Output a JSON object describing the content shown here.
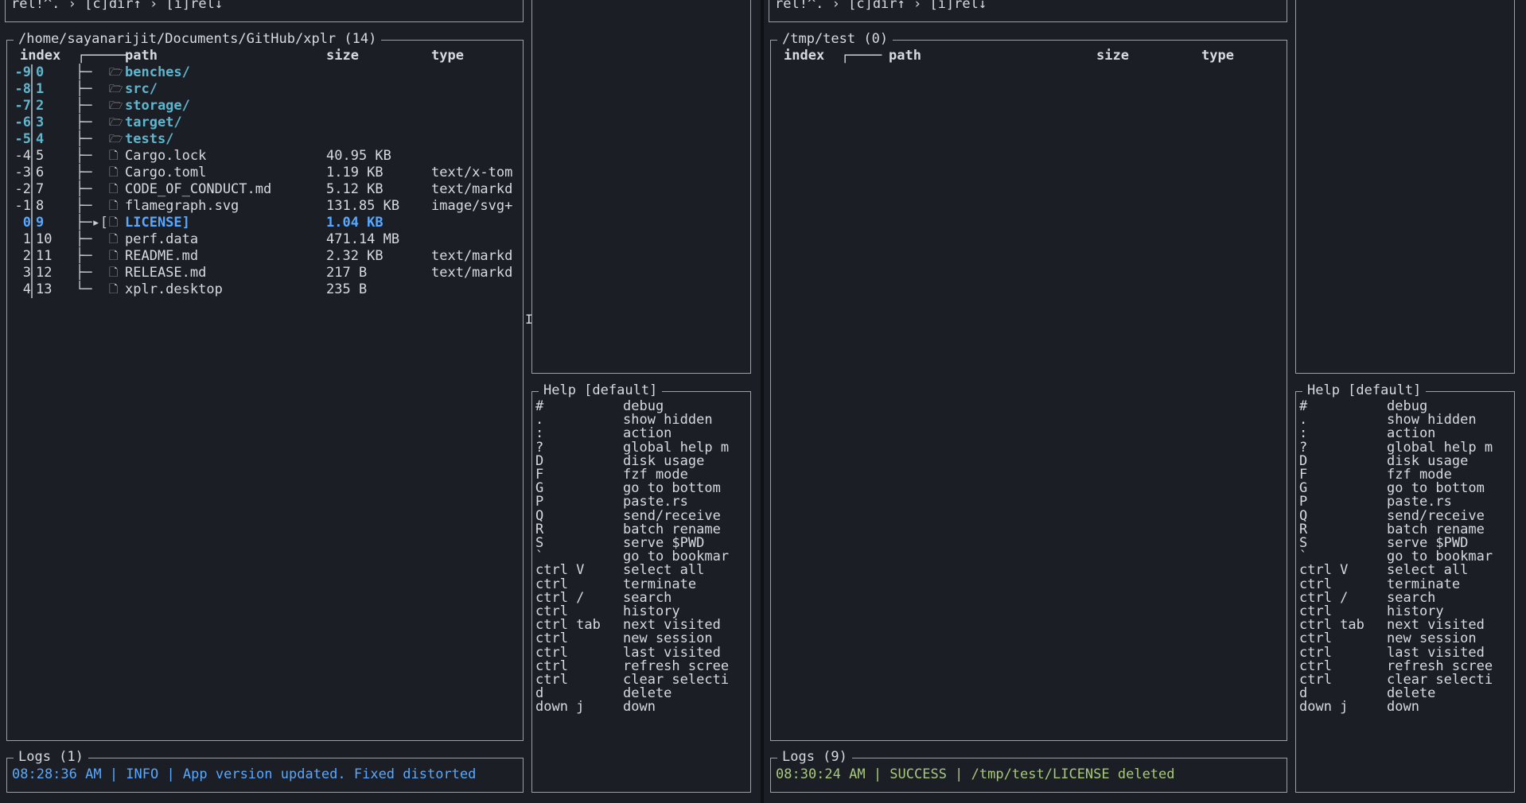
{
  "left": {
    "breadcrumb": "rel!^. › [c]dir↑ › [i]rel↓",
    "table_title": "/home/sayanarijit/Documents/GitHub/xplr (14)",
    "columns": {
      "index": "index",
      "tree": "┌─────",
      "path": "path",
      "size": "size",
      "type": "type"
    },
    "rows": [
      {
        "rel": "-9",
        "idx": "0",
        "tree": "├─",
        "icon": "🗁",
        "path": "benches/",
        "size": "",
        "type": "",
        "kind": "dir"
      },
      {
        "rel": "-8",
        "idx": "1",
        "tree": "├─",
        "icon": "🗁",
        "path": "src/",
        "size": "",
        "type": "",
        "kind": "dir"
      },
      {
        "rel": "-7",
        "idx": "2",
        "tree": "├─",
        "icon": "🗁",
        "path": "storage/",
        "size": "",
        "type": "",
        "kind": "dir"
      },
      {
        "rel": "-6",
        "idx": "3",
        "tree": "├─",
        "icon": "🗁",
        "path": "target/",
        "size": "",
        "type": "",
        "kind": "dir"
      },
      {
        "rel": "-5",
        "idx": "4",
        "tree": "├─",
        "icon": "🗁",
        "path": "tests/",
        "size": "",
        "type": "",
        "kind": "dir"
      },
      {
        "rel": "-4",
        "idx": "5",
        "tree": "├─",
        "icon": "🗋",
        "path": "Cargo.lock",
        "size": "40.95 KB",
        "type": "",
        "kind": "file"
      },
      {
        "rel": "-3",
        "idx": "6",
        "tree": "├─",
        "icon": "🗋",
        "path": "Cargo.toml",
        "size": "1.19 KB",
        "type": "text/x-tom",
        "kind": "file"
      },
      {
        "rel": "-2",
        "idx": "7",
        "tree": "├─",
        "icon": "🗋",
        "path": "CODE_OF_CONDUCT.md",
        "size": "5.12 KB",
        "type": "text/markd",
        "kind": "file"
      },
      {
        "rel": "-1",
        "idx": "8",
        "tree": "├─",
        "icon": "🗋",
        "path": "flamegraph.svg",
        "size": "131.85 KB",
        "type": "image/svg+",
        "kind": "file"
      },
      {
        "rel": "0",
        "idx": "9",
        "tree": "├─▸[",
        "icon": "🗋",
        "path": "LICENSE]",
        "size": "1.04 KB",
        "type": "",
        "kind": "selected"
      },
      {
        "rel": "1",
        "idx": "10",
        "tree": "├─",
        "icon": "🗋",
        "path": "perf.data",
        "size": "471.14 MB",
        "type": "",
        "kind": "file"
      },
      {
        "rel": "2",
        "idx": "11",
        "tree": "├─",
        "icon": "🗋",
        "path": "README.md",
        "size": "2.32 KB",
        "type": "text/markd",
        "kind": "file"
      },
      {
        "rel": "3",
        "idx": "12",
        "tree": "├─",
        "icon": "🗋",
        "path": "RELEASE.md",
        "size": "217 B",
        "type": "text/markd",
        "kind": "file"
      },
      {
        "rel": "4",
        "idx": "13",
        "tree": "└─",
        "icon": "🗋",
        "path": "xplr.desktop",
        "size": "235 B",
        "type": "",
        "kind": "file"
      }
    ],
    "help_title": "Help [default]",
    "logs_title": "Logs (1)",
    "log_line": "08:28:36 AM | INFO | App version updated. Fixed distorted"
  },
  "right": {
    "breadcrumb": "rel!^. › [c]dir↑ › [i]rel↓",
    "table_title": "/tmp/test (0)",
    "columns": {
      "index": "index",
      "tree": "┌────",
      "path": "path",
      "size": "size",
      "type": "type"
    },
    "help_title": "Help [default]",
    "logs_title": "Logs (9)",
    "log_line": "08:30:24 AM | SUCCESS | /tmp/test/LICENSE deleted"
  },
  "help": [
    {
      "key": "#",
      "action": "debug"
    },
    {
      "key": ".",
      "action": "show hidden"
    },
    {
      "key": ":",
      "action": "action"
    },
    {
      "key": "?",
      "action": "global help m"
    },
    {
      "key": "D",
      "action": "disk usage"
    },
    {
      "key": "F",
      "action": "fzf mode"
    },
    {
      "key": "G",
      "action": "go to bottom"
    },
    {
      "key": "P",
      "action": "paste.rs"
    },
    {
      "key": "Q",
      "action": "send/receive"
    },
    {
      "key": "R",
      "action": "batch rename"
    },
    {
      "key": "S",
      "action": "serve $PWD"
    },
    {
      "key": "`",
      "action": "go to bookmar"
    },
    {
      "key": "ctrl V",
      "action": "select all"
    },
    {
      "key": "ctrl",
      "action": "terminate"
    },
    {
      "key": "ctrl /",
      "action": "search"
    },
    {
      "key": "ctrl",
      "action": "history"
    },
    {
      "key": "ctrl tab",
      "action": "next visited"
    },
    {
      "key": "ctrl",
      "action": "new session"
    },
    {
      "key": "ctrl",
      "action": "last visited"
    },
    {
      "key": "ctrl",
      "action": "refresh scree"
    },
    {
      "key": "ctrl",
      "action": "clear selecti"
    },
    {
      "key": "d",
      "action": "delete"
    },
    {
      "key": "down j",
      "action": "down"
    }
  ]
}
